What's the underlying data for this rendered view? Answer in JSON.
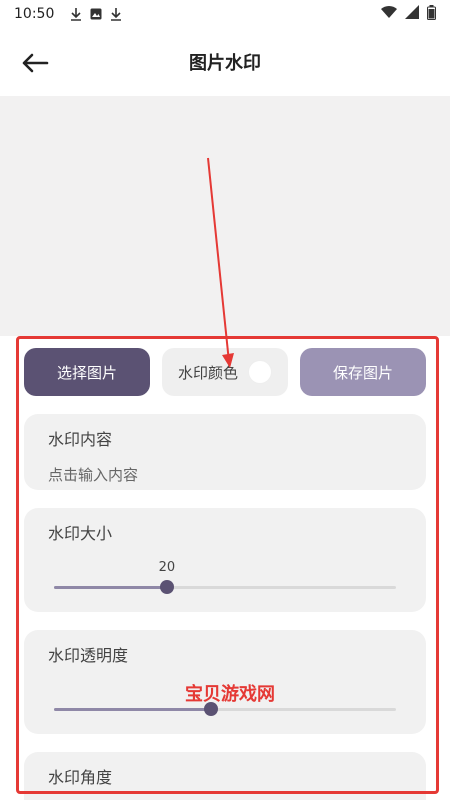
{
  "status": {
    "time": "10:50"
  },
  "header": {
    "title": "图片水印"
  },
  "buttons": {
    "select": "选择图片",
    "color": "水印颜色",
    "save": "保存图片"
  },
  "colors": {
    "primary": "#5b5273",
    "secondary": "#9b93b4",
    "watermark_color": "#ffffff"
  },
  "content_card": {
    "title": "水印内容",
    "placeholder": "点击输入内容"
  },
  "size_card": {
    "title": "水印大小",
    "value": "20",
    "fraction": 0.33
  },
  "opacity_card": {
    "title": "水印透明度",
    "fraction": 0.46
  },
  "angle_card": {
    "title": "水印角度"
  },
  "overlay_text": "宝贝游戏网"
}
